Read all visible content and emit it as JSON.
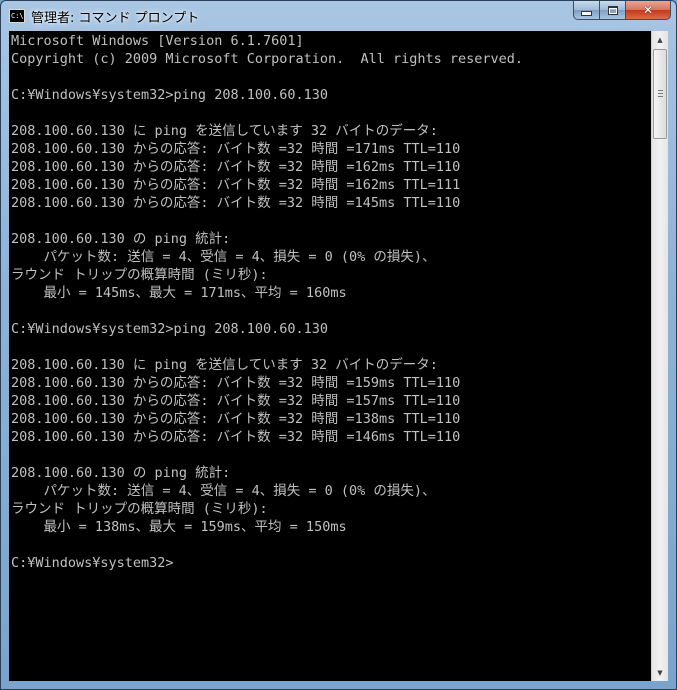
{
  "window": {
    "title": "管理者: コマンド プロンプト",
    "icon_label": "C:\\"
  },
  "controls": {
    "minimize": "minimize",
    "maximize": "maximize",
    "close": "✕"
  },
  "console": {
    "lines": [
      "Microsoft Windows [Version 6.1.7601]",
      "Copyright (c) 2009 Microsoft Corporation.  All rights reserved.",
      "",
      "C:¥Windows¥system32>ping 208.100.60.130",
      "",
      "208.100.60.130 に ping を送信しています 32 バイトのデータ:",
      "208.100.60.130 からの応答: バイト数 =32 時間 =171ms TTL=110",
      "208.100.60.130 からの応答: バイト数 =32 時間 =162ms TTL=110",
      "208.100.60.130 からの応答: バイト数 =32 時間 =162ms TTL=111",
      "208.100.60.130 からの応答: バイト数 =32 時間 =145ms TTL=110",
      "",
      "208.100.60.130 の ping 統計:",
      "    パケット数: 送信 = 4、受信 = 4、損失 = 0 (0% の損失)、",
      "ラウンド トリップの概算時間 (ミリ秒):",
      "    最小 = 145ms、最大 = 171ms、平均 = 160ms",
      "",
      "C:¥Windows¥system32>ping 208.100.60.130",
      "",
      "208.100.60.130 に ping を送信しています 32 バイトのデータ:",
      "208.100.60.130 からの応答: バイト数 =32 時間 =159ms TTL=110",
      "208.100.60.130 からの応答: バイト数 =32 時間 =157ms TTL=110",
      "208.100.60.130 からの応答: バイト数 =32 時間 =138ms TTL=110",
      "208.100.60.130 からの応答: バイト数 =32 時間 =146ms TTL=110",
      "",
      "208.100.60.130 の ping 統計:",
      "    パケット数: 送信 = 4、受信 = 4、損失 = 0 (0% の損失)、",
      "ラウンド トリップの概算時間 (ミリ秒):",
      "    最小 = 138ms、最大 = 159ms、平均 = 150ms",
      "",
      "C:¥Windows¥system32>"
    ]
  },
  "scrollbar": {
    "position": 0.0,
    "up_arrow": "▲",
    "down_arrow": "▼"
  }
}
